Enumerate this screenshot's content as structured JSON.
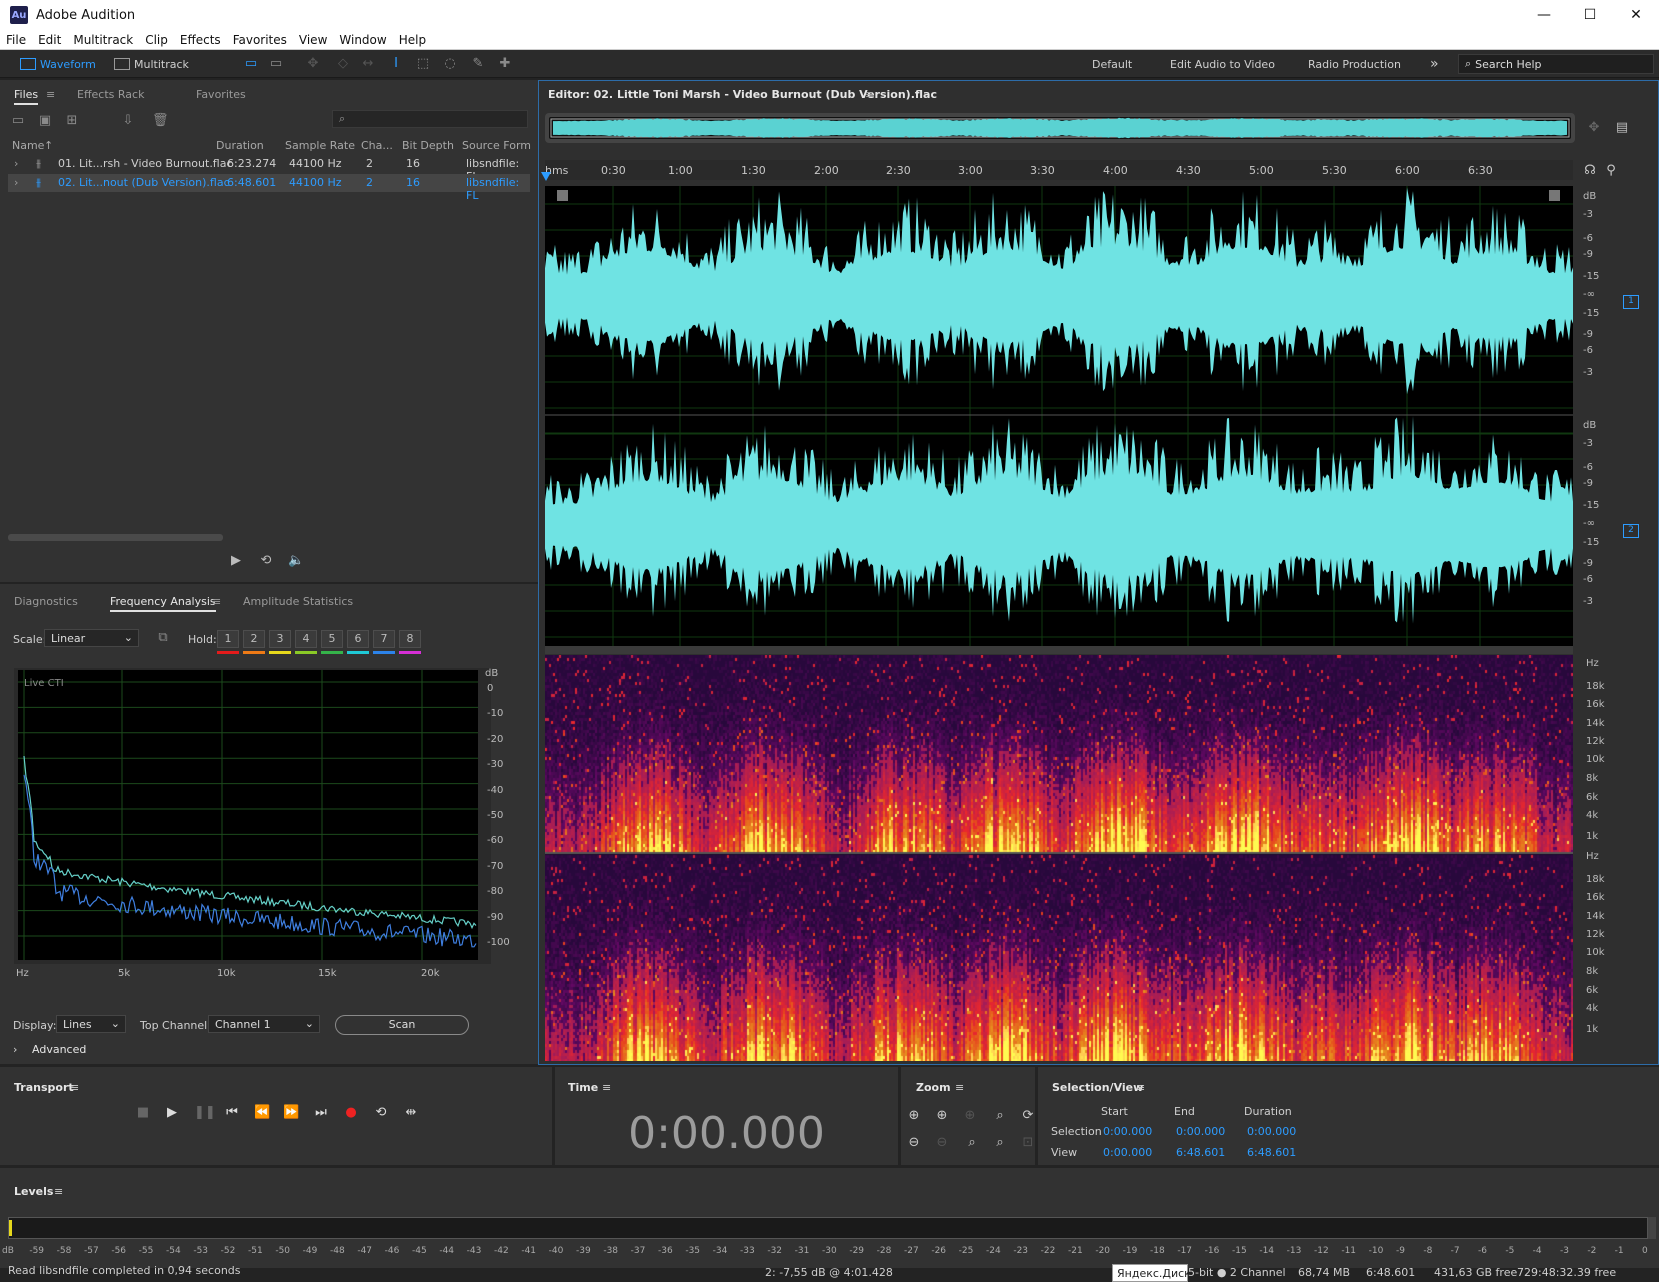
{
  "app": {
    "logo": "Au",
    "title": "Adobe Audition",
    "min": "—",
    "max": "☐",
    "close": "✕"
  },
  "menu": [
    "File",
    "Edit",
    "Multitrack",
    "Clip",
    "Effects",
    "Favorites",
    "View",
    "Window",
    "Help"
  ],
  "toolbar": {
    "waveform": "Waveform",
    "multitrack": "Multitrack",
    "workspaces": [
      "Default",
      "Edit Audio to Video",
      "Radio Production"
    ],
    "more": "»",
    "search": "Search Help"
  },
  "files": {
    "tabs": [
      "Files",
      "Effects Rack",
      "Favorites"
    ],
    "columns": [
      "Name",
      "Duration",
      "Sample Rate",
      "Cha...",
      "Bit Depth",
      "Source Form"
    ],
    "rows": [
      {
        "name": "01. Lit...rsh - Video Burnout.flac",
        "duration": "6:23.274",
        "rate": "44100 Hz",
        "ch": "2",
        "bits": "16",
        "src": "libsndfile: FL"
      },
      {
        "name": "02. Lit...nout (Dub Version).flac",
        "duration": "6:48.601",
        "rate": "44100 Hz",
        "ch": "2",
        "bits": "16",
        "src": "libsndfile: FL"
      }
    ]
  },
  "freq": {
    "tabs": [
      "Diagnostics",
      "Frequency Analysis",
      "Amplitude Statistics"
    ],
    "scale_label": "Scale:",
    "scale": "Linear",
    "hold_label": "Hold:",
    "hold": [
      "1",
      "2",
      "3",
      "4",
      "5",
      "6",
      "7",
      "8"
    ],
    "hold_colors": [
      "#e41b1b",
      "#ee7a16",
      "#e6d81c",
      "#8ac926",
      "#35b34a",
      "#1fc9d6",
      "#2c83ea",
      "#d62fd6"
    ],
    "live": "Live CTI",
    "db_unit": "dB",
    "db": [
      "0",
      "-10",
      "-20",
      "-30",
      "-40",
      "-50",
      "-60",
      "-70",
      "-80",
      "-90",
      "-100"
    ],
    "hz": [
      "Hz",
      "5k",
      "10k",
      "15k",
      "20k"
    ],
    "display_label": "Display:",
    "display": "Lines",
    "top_channel_label": "Top Channel:",
    "top_channel": "Channel 1",
    "scan": "Scan",
    "advanced": "Advanced"
  },
  "editor": {
    "title": "Editor: 02. Little Toni Marsh - Video Burnout (Dub Version).flac",
    "ruler": [
      "hms",
      "0:30",
      "1:00",
      "1:30",
      "2:00",
      "2:30",
      "3:00",
      "3:30",
      "4:00",
      "4:30",
      "5:00",
      "5:30",
      "6:00",
      "6:30"
    ],
    "db_unit": "dB",
    "db_top": [
      "-3",
      "-6",
      "-9",
      "-15",
      "-∞",
      "-15",
      "-9",
      "-6",
      "-3"
    ],
    "ch": [
      "1",
      "2"
    ],
    "hz_unit": "Hz",
    "hz": [
      "18k",
      "16k",
      "14k",
      "12k",
      "10k",
      "8k",
      "6k",
      "4k",
      "1k"
    ]
  },
  "transport": {
    "title": "Transport"
  },
  "time": {
    "title": "Time",
    "value": "0:00.000"
  },
  "zoom": {
    "title": "Zoom"
  },
  "selview": {
    "title": "Selection/View",
    "cols": [
      "Start",
      "End",
      "Duration"
    ],
    "rows": [
      {
        "label": "Selection",
        "start": "0:00.000",
        "end": "0:00.000",
        "dur": "0:00.000"
      },
      {
        "label": "View",
        "start": "0:00.000",
        "end": "6:48.601",
        "dur": "6:48.601"
      }
    ]
  },
  "levels": {
    "title": "Levels",
    "ticks": [
      "dB",
      "-59",
      "-58",
      "-57",
      "-56",
      "-55",
      "-54",
      "-53",
      "-52",
      "-51",
      "-50",
      "-49",
      "-48",
      "-47",
      "-46",
      "-45",
      "-44",
      "-43",
      "-42",
      "-41",
      "-40",
      "-39",
      "-38",
      "-37",
      "-36",
      "-35",
      "-34",
      "-33",
      "-32",
      "-31",
      "-30",
      "-29",
      "-28",
      "-27",
      "-26",
      "-25",
      "-24",
      "-23",
      "-22",
      "-21",
      "-20",
      "-19",
      "-18",
      "-17",
      "-16",
      "-15",
      "-14",
      "-13",
      "-12",
      "-11",
      "-10",
      "-9",
      "-8",
      "-7",
      "-6",
      "-5",
      "-4",
      "-3",
      "-2",
      "-1",
      "0"
    ]
  },
  "status": {
    "left": "Read libsndfile completed in 0,94 seconds",
    "cursor": "2: -7,55 dB @ 4:01.428",
    "tooltip": "Яндекс.Диск",
    "format": "5-bit ● 2 Channel",
    "size": "68,74 MB",
    "duration": "6:48.601",
    "free": "431,63 GB free",
    "time_free": "729:48:32.39 free"
  }
}
